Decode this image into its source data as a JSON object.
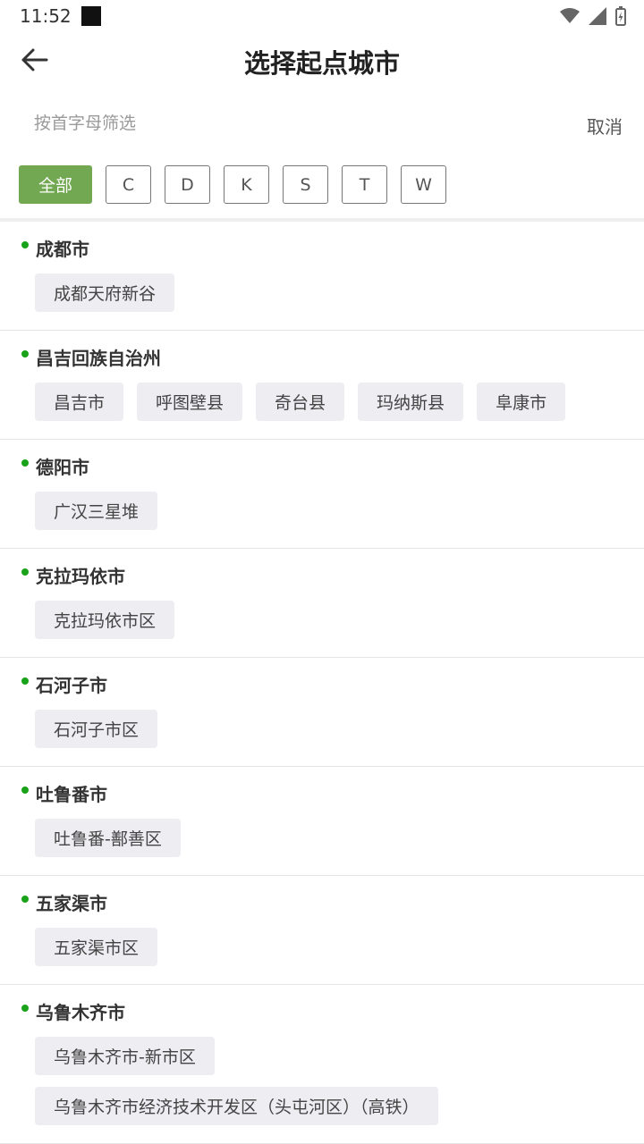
{
  "status_bar": {
    "time": "11:52"
  },
  "header": {
    "title": "选择起点城市"
  },
  "search": {
    "placeholder": "按首字母筛选",
    "value": "",
    "cancel_label": "取消"
  },
  "filters": [
    "全部",
    "C",
    "D",
    "K",
    "S",
    "T",
    "W"
  ],
  "active_filter": "全部",
  "accent_color": "#72a851",
  "dot_color": "#1aa21a",
  "groups": [
    {
      "name": "成都市",
      "items": [
        "成都天府新谷"
      ]
    },
    {
      "name": "昌吉回族自治州",
      "items": [
        "昌吉市",
        "呼图壁县",
        "奇台县",
        "玛纳斯县",
        "阜康市"
      ]
    },
    {
      "name": "德阳市",
      "items": [
        "广汉三星堆"
      ]
    },
    {
      "name": "克拉玛依市",
      "items": [
        "克拉玛依市区"
      ]
    },
    {
      "name": "石河子市",
      "items": [
        "石河子市区"
      ]
    },
    {
      "name": "吐鲁番市",
      "items": [
        "吐鲁番-鄯善区"
      ]
    },
    {
      "name": "五家渠市",
      "items": [
        "五家渠市区"
      ]
    },
    {
      "name": "乌鲁木齐市",
      "items": [
        "乌鲁木齐市-新市区",
        "乌鲁木齐市经济技术开发区（头屯河区）（高铁）"
      ]
    }
  ]
}
